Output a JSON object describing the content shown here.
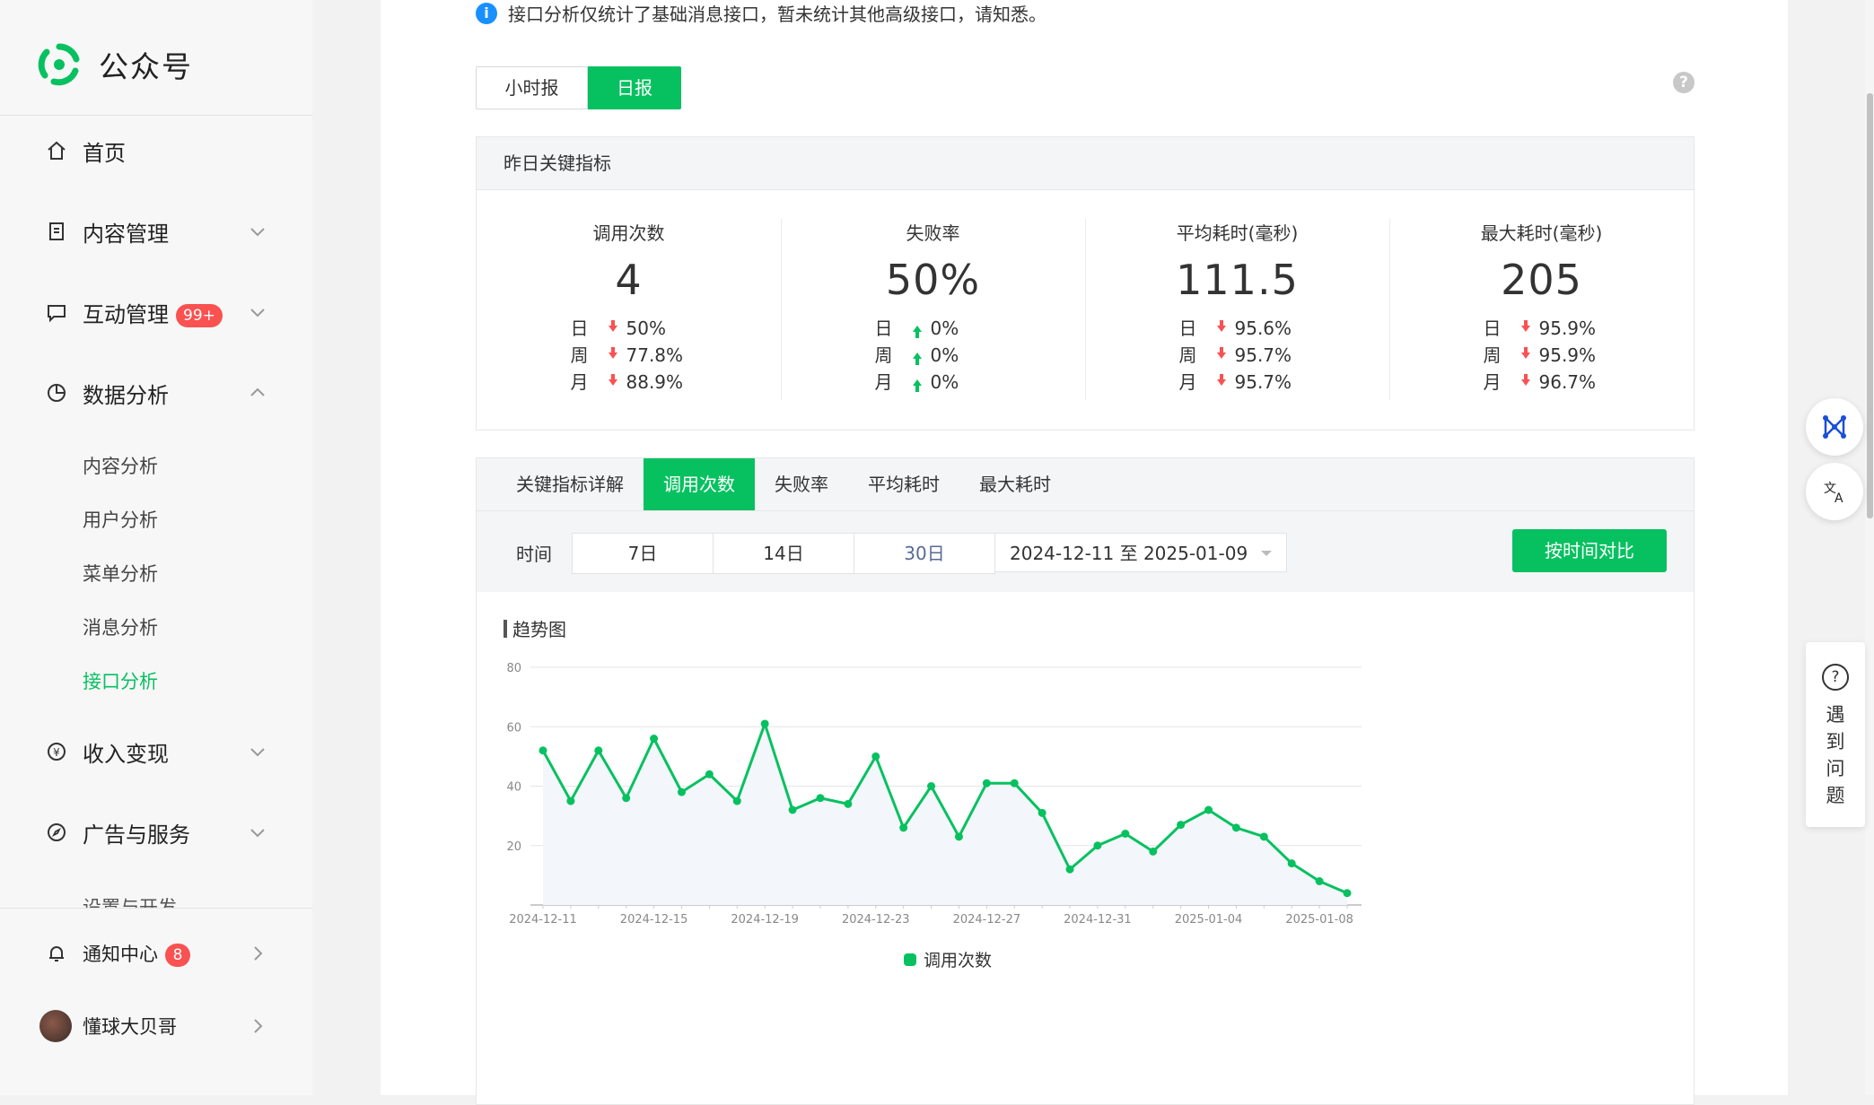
{
  "app": {
    "name": "公众号"
  },
  "sidebar": {
    "items": [
      {
        "label": "首页"
      },
      {
        "label": "内容管理"
      },
      {
        "label": "互动管理",
        "badge": "99+"
      },
      {
        "label": "数据分析"
      },
      {
        "label": "收入变现"
      },
      {
        "label": "广告与服务"
      }
    ],
    "sub_items": [
      "内容分析",
      "用户分析",
      "菜单分析",
      "消息分析",
      "接口分析"
    ],
    "cut_label": "设置与开发",
    "notify": {
      "label": "通知中心",
      "badge": "8"
    },
    "user": {
      "name": "懂球大贝哥"
    }
  },
  "notice": {
    "text": "接口分析仅统计了基础消息接口，暂未统计其他高级接口，请知悉。"
  },
  "report_toggle": {
    "hourly": "小时报",
    "daily": "日报"
  },
  "key_metrics": {
    "title": "昨日关键指标",
    "cmp_labels": [
      "日",
      "周",
      "月"
    ],
    "items": [
      {
        "label": "调用次数",
        "value": "4",
        "cmp": [
          {
            "dir": "down",
            "v": "50%"
          },
          {
            "dir": "down",
            "v": "77.8%"
          },
          {
            "dir": "down",
            "v": "88.9%"
          }
        ]
      },
      {
        "label": "失败率",
        "value": "50%",
        "cmp": [
          {
            "dir": "up",
            "v": "0%"
          },
          {
            "dir": "up",
            "v": "0%"
          },
          {
            "dir": "up",
            "v": "0%"
          }
        ]
      },
      {
        "label": "平均耗时(毫秒)",
        "value": "111.5",
        "cmp": [
          {
            "dir": "down",
            "v": "95.6%"
          },
          {
            "dir": "down",
            "v": "95.7%"
          },
          {
            "dir": "down",
            "v": "95.7%"
          }
        ]
      },
      {
        "label": "最大耗时(毫秒)",
        "value": "205",
        "cmp": [
          {
            "dir": "down",
            "v": "95.9%"
          },
          {
            "dir": "down",
            "v": "95.9%"
          },
          {
            "dir": "down",
            "v": "96.7%"
          }
        ]
      }
    ]
  },
  "detail_tabs": [
    "关键指标详解",
    "调用次数",
    "失败率",
    "平均耗时",
    "最大耗时"
  ],
  "filter": {
    "label": "时间",
    "ranges": [
      "7日",
      "14日",
      "30日"
    ],
    "date_range": "2024-12-11 至 2025-01-09",
    "compare_button": "按时间对比"
  },
  "trend": {
    "title": "趋势图"
  },
  "chart_data": {
    "type": "line",
    "title": "趋势图",
    "x": [
      "2024-12-11",
      "2024-12-12",
      "2024-12-13",
      "2024-12-14",
      "2024-12-15",
      "2024-12-16",
      "2024-12-17",
      "2024-12-18",
      "2024-12-19",
      "2024-12-20",
      "2024-12-21",
      "2024-12-22",
      "2024-12-23",
      "2024-12-24",
      "2024-12-25",
      "2024-12-26",
      "2024-12-27",
      "2024-12-28",
      "2024-12-29",
      "2024-12-30",
      "2024-12-31",
      "2025-01-01",
      "2025-01-02",
      "2025-01-03",
      "2025-01-04",
      "2025-01-05",
      "2025-01-06",
      "2025-01-07",
      "2025-01-08",
      "2025-01-09"
    ],
    "x_ticks": [
      "2024-12-11",
      "2024-12-15",
      "2024-12-19",
      "2024-12-23",
      "2024-12-27",
      "2024-12-31",
      "2025-01-04",
      "2025-01-08"
    ],
    "series": [
      {
        "name": "调用次数",
        "values": [
          52,
          35,
          52,
          36,
          56,
          38,
          44,
          35,
          61,
          32,
          36,
          34,
          50,
          26,
          40,
          23,
          41,
          41,
          31,
          12,
          20,
          24,
          18,
          27,
          32,
          26,
          23,
          14,
          8,
          4
        ]
      }
    ],
    "ylim": [
      0,
      80
    ],
    "y_ticks": [
      20,
      40,
      60,
      80
    ],
    "color": "#07c160",
    "legend": "bottom-center",
    "grid": true
  },
  "help": {
    "text": "遇到问题"
  }
}
